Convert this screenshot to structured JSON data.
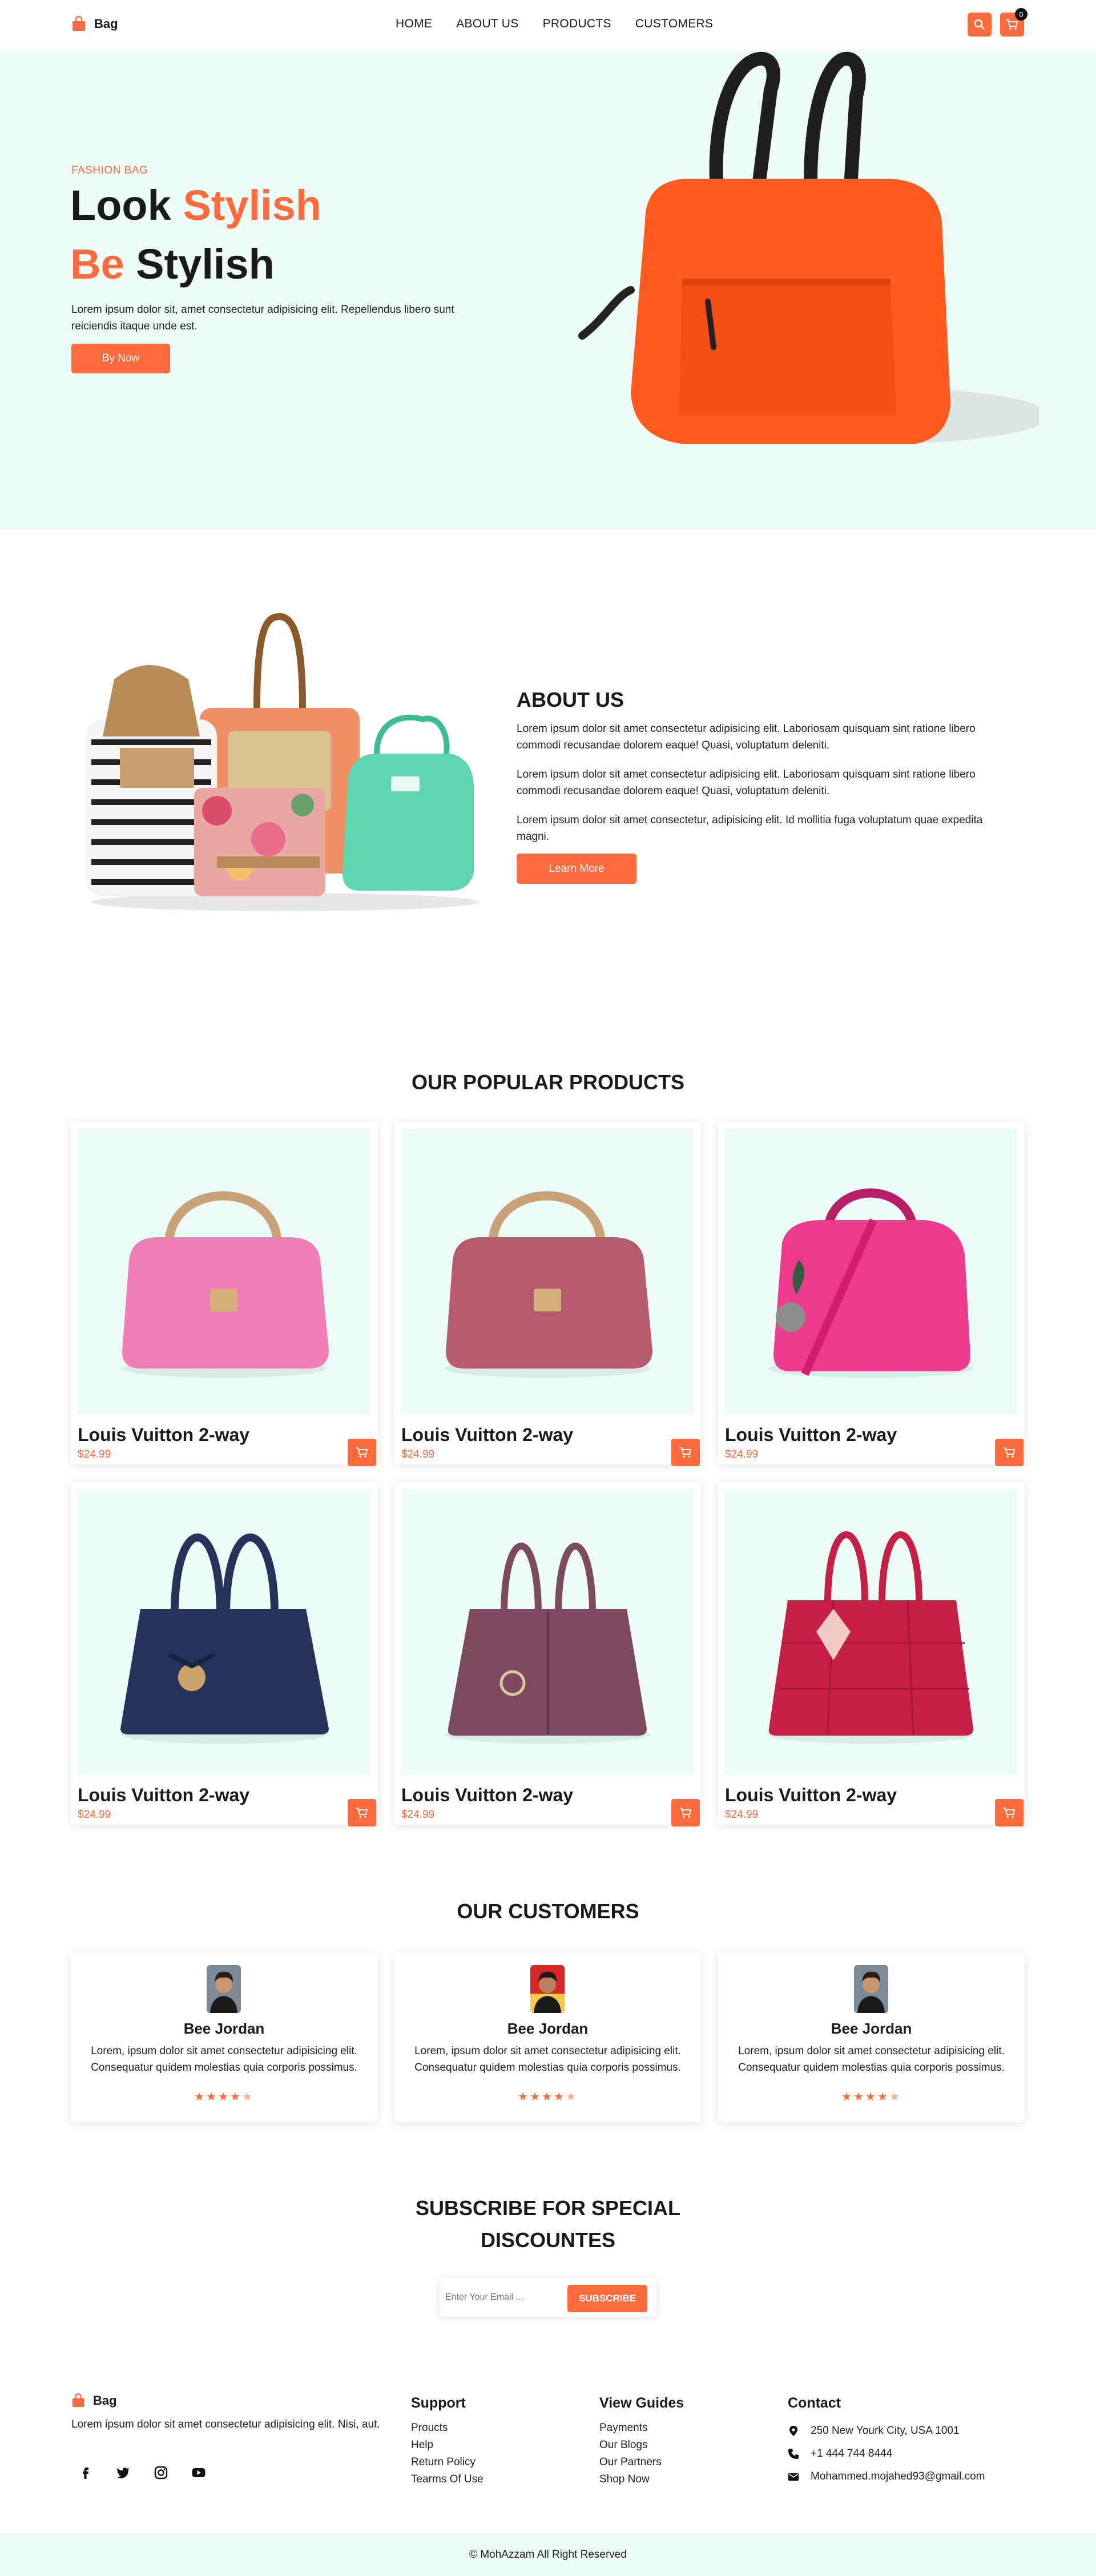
{
  "brand": {
    "name": "Bag",
    "accent": "#ff6b3d",
    "mint": "#ecfbf5"
  },
  "nav": [
    "HOME",
    "ABOUT US",
    "PRODUCTS",
    "CUSTOMERS"
  ],
  "header": {
    "cart_count": "0",
    "search_icon": "search-icon",
    "cart_icon": "cart-icon"
  },
  "hero": {
    "eyebrow": "FASHION BAG",
    "line1_a": "Look",
    "line1_b": "Stylish",
    "line2_a": "Be",
    "line2_b": "Stylish",
    "text": "Lorem ipsum dolor sit, amet consectetur adipisicing elit. Repellendus libero sunt reiciendis itaque unde est.",
    "cta": "By Now"
  },
  "about": {
    "title": "ABOUT US",
    "p1": "Lorem ipsum dolor sit amet consectetur adipisicing elit. Laboriosam quisquam sint ratione libero commodi recusandae dolorem eaque! Quasi, voluptatum deleniti.",
    "p2": "Lorem ipsum dolor sit amet consectetur adipisicing elit. Laboriosam quisquam sint ratione libero commodi recusandae dolorem eaque! Quasi, voluptatum deleniti.",
    "p3": "Lorem ipsum dolor sit amet consectetur, adipisicing elit. Id mollitia fuga voluptatum quae expedita magni.",
    "cta": "Learn More"
  },
  "products": {
    "title": "OUR POPULAR PRODUCTS",
    "items": [
      {
        "name": "Louis Vuitton 2-way",
        "price": "$24.99",
        "color": "#f07fb8"
      },
      {
        "name": "Louis Vuitton 2-way",
        "price": "$24.99",
        "color": "#b65a6f"
      },
      {
        "name": "Louis Vuitton 2-way",
        "price": "$24.99",
        "color": "#ee3a8c"
      },
      {
        "name": "Louis Vuitton 2-way",
        "price": "$24.99",
        "color": "#27325a"
      },
      {
        "name": "Louis Vuitton 2-way",
        "price": "$24.99",
        "color": "#7c4a5e"
      },
      {
        "name": "Louis Vuitton 2-way",
        "price": "$24.99",
        "color": "#c51f45"
      }
    ]
  },
  "customers": {
    "title": "OUR CUSTOMERS",
    "items": [
      {
        "name": "Bee Jordan",
        "text": "Lorem, ipsum dolor sit amet consectetur adipisicing elit. Consequatur quidem molestias quia corporis possimus.",
        "rating": 4.5
      },
      {
        "name": "Bee Jordan",
        "text": "Lorem, ipsum dolor sit amet consectetur adipisicing elit. Consequatur quidem molestias quia corporis possimus.",
        "rating": 4.5
      },
      {
        "name": "Bee Jordan",
        "text": "Lorem, ipsum dolor sit amet consectetur adipisicing elit. Consequatur quidem molestias quia corporis possimus.",
        "rating": 4.5
      }
    ]
  },
  "subscribe": {
    "title_1": "SUBSCRIBE FOR SPECIAL",
    "title_2": "DISCOUNTES",
    "placeholder": "Enter Your Email ...",
    "button": "SUBSCRIBE"
  },
  "footer": {
    "brand": "Bag",
    "desc": "Lorem ipsum dolor sit amet consectetur adipisicing elit. Nisi, aut.",
    "support_title": "Support",
    "support": [
      "Proucts",
      "Help",
      "Return Policy",
      "Tearms Of Use"
    ],
    "guides_title": "View Guides",
    "guides": [
      "Payments",
      "Our Blogs",
      "Our Partners",
      "Shop Now"
    ],
    "contact_title": "Contact",
    "address": "250 New Yourk City, USA 1001",
    "phone": "+1 444 744 8444",
    "email": "Mohammed.mojahed93@gmail.com",
    "copyright": "© MohAzzam All Right Reserved"
  }
}
